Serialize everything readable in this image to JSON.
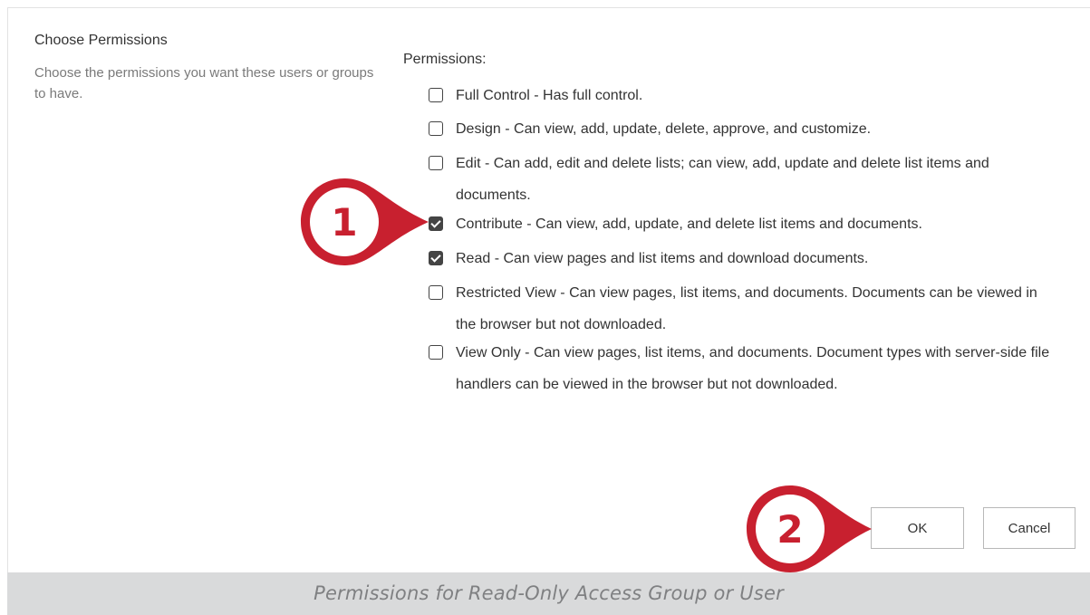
{
  "section": {
    "title": "Choose Permissions",
    "description": "Choose the permissions you want these users or groups to have."
  },
  "permissions": {
    "label": "Permissions:",
    "items": [
      {
        "label": "Full Control - Has full control.",
        "checked": false
      },
      {
        "label": "Design - Can view, add, update, delete, approve, and customize.",
        "checked": false
      },
      {
        "label": "Edit - Can add, edit and delete lists; can view, add, update and delete list items and documents.",
        "checked": false
      },
      {
        "label": "Contribute - Can view, add, update, and delete list items and documents.",
        "checked": true
      },
      {
        "label": "Read - Can view pages and list items and download documents.",
        "checked": true
      },
      {
        "label": "Restricted View - Can view pages, list items, and documents. Documents can be viewed in the browser but not downloaded.",
        "checked": false
      },
      {
        "label": "View Only - Can view pages, list items, and documents. Document types with server-side file handlers can be viewed in the browser but not downloaded.",
        "checked": false
      }
    ]
  },
  "buttons": {
    "ok": "OK",
    "cancel": "Cancel"
  },
  "markers": {
    "step1": "1",
    "step2": "2",
    "color": "#c8202f"
  },
  "caption": "Permissions for Read-Only Access Group or User"
}
